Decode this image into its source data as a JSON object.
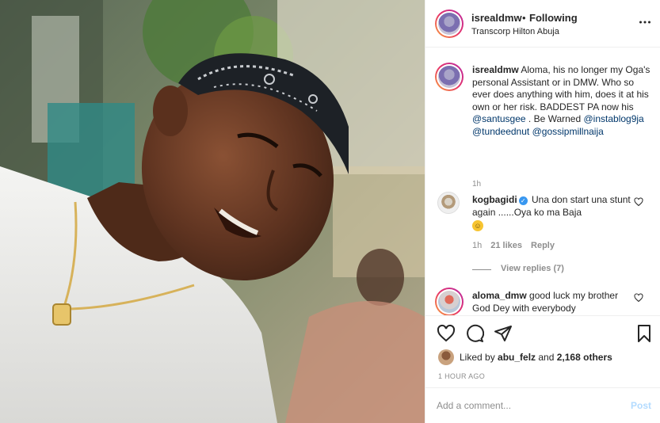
{
  "header": {
    "username": "isrealdmw",
    "separator": "•",
    "follow_status": "Following",
    "location": "Transcorp Hilton Abuja",
    "more_icon": "more-horizontal-icon"
  },
  "caption": {
    "username": "isrealdmw",
    "text": "Aloma, his no longer my Oga's personal Assistant or in DMW. Who so ever does anything with him, does it at his own or her risk. BADDEST PA now his ",
    "mention_1": "@santusgee",
    "text_2": " . Be Warned ",
    "mention_2": "@instablog9ja",
    "mention_3": "@tundeednut",
    "mention_4": "@gossipmillnaija",
    "time": "1h"
  },
  "comments": [
    {
      "username": "kogbagidi",
      "verified": true,
      "text": "Una don start una stunt again ......Oya ko ma Baja",
      "emoji": "rofl-emoji",
      "time": "1h",
      "likes": "21 likes",
      "reply_label": "Reply",
      "view_replies": "View replies (7)"
    },
    {
      "username": "aloma_dmw",
      "text": "good luck my brother God Dey with everybody"
    }
  ],
  "actions": {
    "liked_by_prefix": "Liked by ",
    "liked_by_user": "abu_felz",
    "liked_by_and": " and ",
    "liked_by_count": "2,168 others",
    "time_ago": "1 HOUR AGO"
  },
  "add_comment": {
    "placeholder": "Add a comment...",
    "post_label": "Post"
  },
  "colors": {
    "link": "#00376b",
    "muted": "#8e8e8e",
    "verified": "#3897f0",
    "post_disabled": "#b3dbff"
  }
}
